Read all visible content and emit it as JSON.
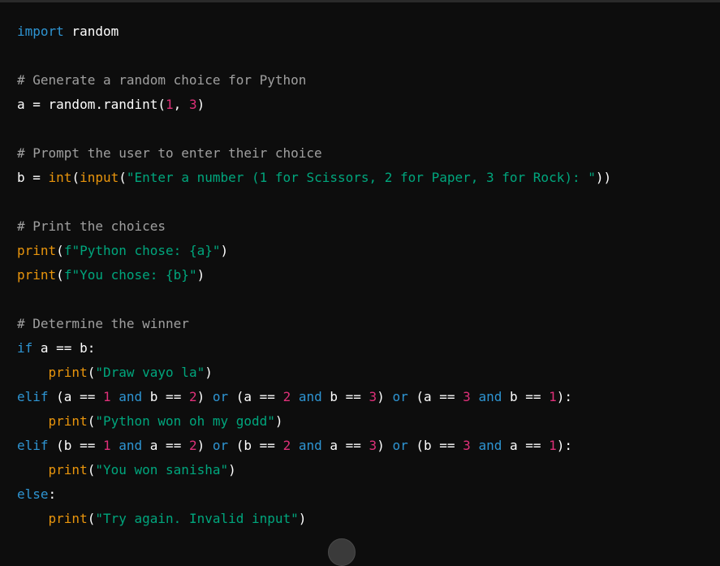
{
  "colors": {
    "background": "#0d0d0d",
    "plain": "#ffffff",
    "keyword": "#2e95d3",
    "comment": "#ffffff99",
    "string": "#00a67d",
    "number": "#df3079",
    "builtin": "#e9950c"
  },
  "code_lines": [
    [
      [
        "keyword",
        "import"
      ],
      [
        "plain",
        " random"
      ]
    ],
    [],
    [
      [
        "comment",
        "# Generate a random choice for Python"
      ]
    ],
    [
      [
        "plain",
        "a = random.randint("
      ],
      [
        "number",
        "1"
      ],
      [
        "plain",
        ", "
      ],
      [
        "number",
        "3"
      ],
      [
        "plain",
        ")"
      ]
    ],
    [],
    [
      [
        "comment",
        "# Prompt the user to enter their choice"
      ]
    ],
    [
      [
        "plain",
        "b = "
      ],
      [
        "builtin",
        "int"
      ],
      [
        "plain",
        "("
      ],
      [
        "builtin",
        "input"
      ],
      [
        "plain",
        "("
      ],
      [
        "string",
        "\"Enter a number (1 for Scissors, 2 for Paper, 3 for Rock): \""
      ],
      [
        "plain",
        "))"
      ]
    ],
    [],
    [
      [
        "comment",
        "# Print the choices"
      ]
    ],
    [
      [
        "builtin",
        "print"
      ],
      [
        "plain",
        "("
      ],
      [
        "string",
        "f\"Python chose: {a}\""
      ],
      [
        "plain",
        ")"
      ]
    ],
    [
      [
        "builtin",
        "print"
      ],
      [
        "plain",
        "("
      ],
      [
        "string",
        "f\"You chose: {b}\""
      ],
      [
        "plain",
        ")"
      ]
    ],
    [],
    [
      [
        "comment",
        "# Determine the winner"
      ]
    ],
    [
      [
        "keyword",
        "if"
      ],
      [
        "plain",
        " a == b:"
      ]
    ],
    [
      [
        "plain",
        "    "
      ],
      [
        "builtin",
        "print"
      ],
      [
        "plain",
        "("
      ],
      [
        "string",
        "\"Draw vayo la\""
      ],
      [
        "plain",
        ")"
      ]
    ],
    [
      [
        "keyword",
        "elif"
      ],
      [
        "plain",
        " (a == "
      ],
      [
        "number",
        "1"
      ],
      [
        "plain",
        " "
      ],
      [
        "keyword",
        "and"
      ],
      [
        "plain",
        " b == "
      ],
      [
        "number",
        "2"
      ],
      [
        "plain",
        ") "
      ],
      [
        "keyword",
        "or"
      ],
      [
        "plain",
        " (a == "
      ],
      [
        "number",
        "2"
      ],
      [
        "plain",
        " "
      ],
      [
        "keyword",
        "and"
      ],
      [
        "plain",
        " b == "
      ],
      [
        "number",
        "3"
      ],
      [
        "plain",
        ") "
      ],
      [
        "keyword",
        "or"
      ],
      [
        "plain",
        " (a == "
      ],
      [
        "number",
        "3"
      ],
      [
        "plain",
        " "
      ],
      [
        "keyword",
        "and"
      ],
      [
        "plain",
        " b == "
      ],
      [
        "number",
        "1"
      ],
      [
        "plain",
        "):"
      ]
    ],
    [
      [
        "plain",
        "    "
      ],
      [
        "builtin",
        "print"
      ],
      [
        "plain",
        "("
      ],
      [
        "string",
        "\"Python won oh my godd\""
      ],
      [
        "plain",
        ")"
      ]
    ],
    [
      [
        "keyword",
        "elif"
      ],
      [
        "plain",
        " (b == "
      ],
      [
        "number",
        "1"
      ],
      [
        "plain",
        " "
      ],
      [
        "keyword",
        "and"
      ],
      [
        "plain",
        " a == "
      ],
      [
        "number",
        "2"
      ],
      [
        "plain",
        ") "
      ],
      [
        "keyword",
        "or"
      ],
      [
        "plain",
        " (b == "
      ],
      [
        "number",
        "2"
      ],
      [
        "plain",
        " "
      ],
      [
        "keyword",
        "and"
      ],
      [
        "plain",
        " a == "
      ],
      [
        "number",
        "3"
      ],
      [
        "plain",
        ") "
      ],
      [
        "keyword",
        "or"
      ],
      [
        "plain",
        " (b == "
      ],
      [
        "number",
        "3"
      ],
      [
        "plain",
        " "
      ],
      [
        "keyword",
        "and"
      ],
      [
        "plain",
        " a == "
      ],
      [
        "number",
        "1"
      ],
      [
        "plain",
        "):"
      ]
    ],
    [
      [
        "plain",
        "    "
      ],
      [
        "builtin",
        "print"
      ],
      [
        "plain",
        "("
      ],
      [
        "string",
        "\"You won sanisha\""
      ],
      [
        "plain",
        ")"
      ]
    ],
    [
      [
        "keyword",
        "else"
      ],
      [
        "plain",
        ":"
      ]
    ],
    [
      [
        "plain",
        "    "
      ],
      [
        "builtin",
        "print"
      ],
      [
        "plain",
        "("
      ],
      [
        "string",
        "\"Try again. Invalid input\""
      ],
      [
        "plain",
        ")"
      ]
    ]
  ]
}
